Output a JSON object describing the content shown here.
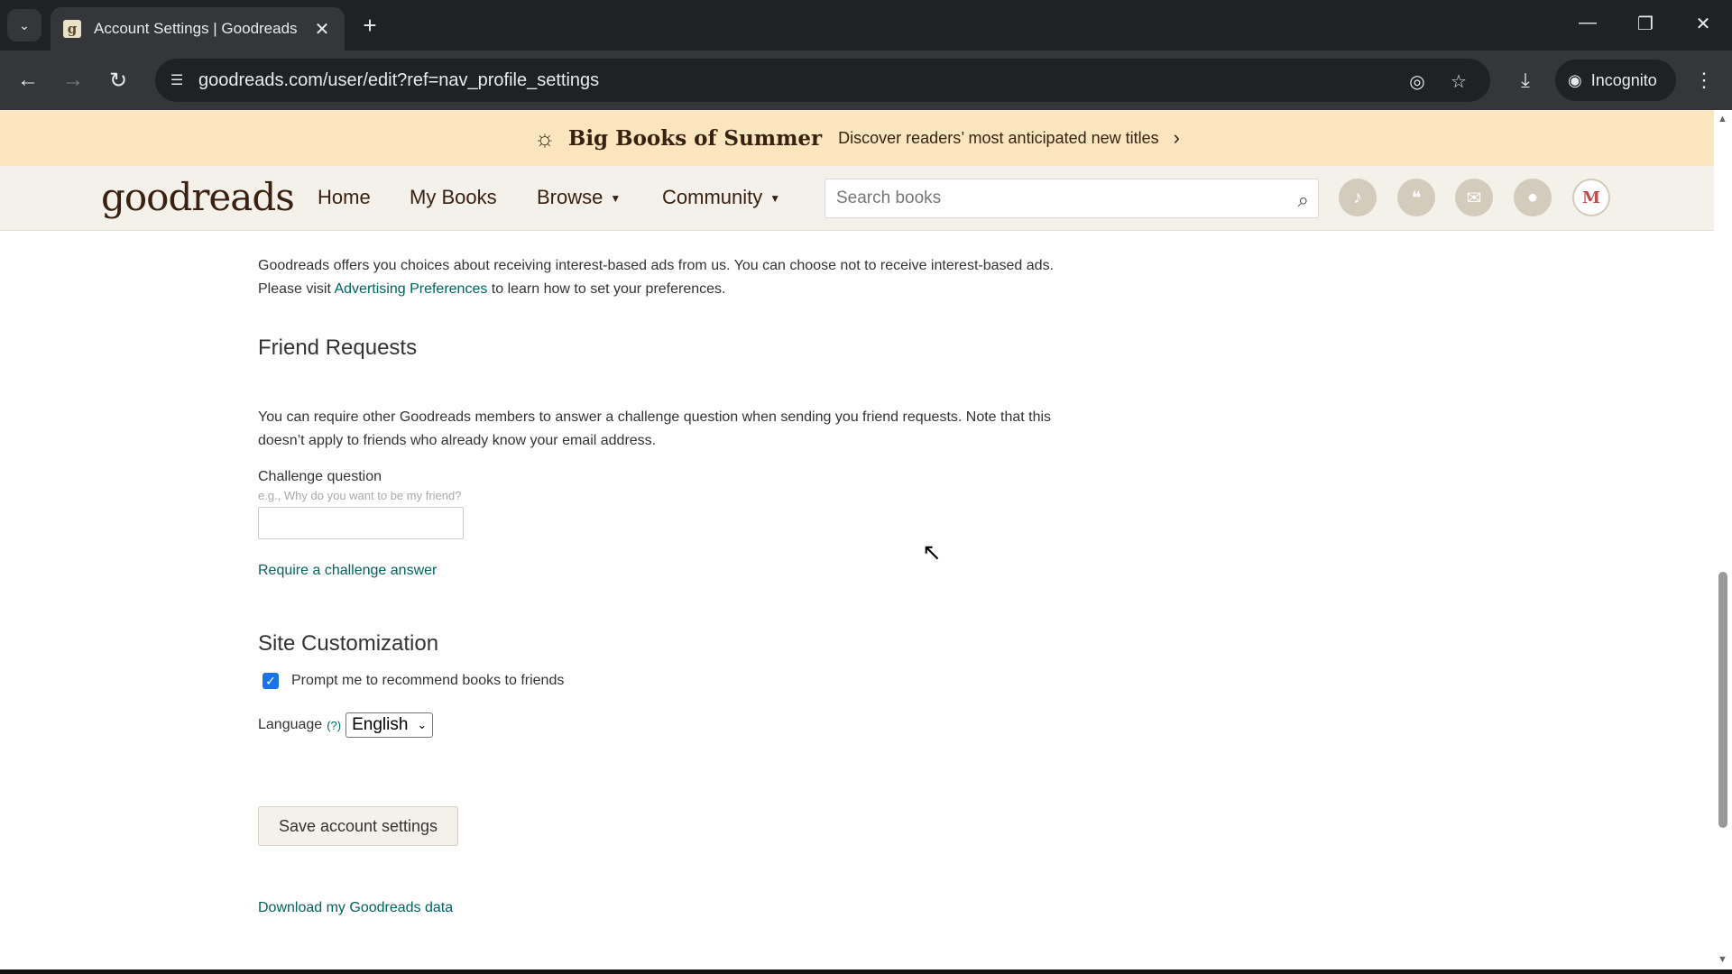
{
  "browser": {
    "tab_title": "Account Settings | Goodreads",
    "url": "goodreads.com/user/edit?ref=nav_profile_settings",
    "incognito_label": "Incognito"
  },
  "promo": {
    "title": "Big Books of Summer",
    "text": "Discover readers’ most anticipated new titles"
  },
  "header": {
    "logo": "goodreads",
    "nav": {
      "home": "Home",
      "my_books": "My Books",
      "browse": "Browse",
      "community": "Community"
    },
    "search_placeholder": "Search books",
    "avatar_letter": "M"
  },
  "ads": {
    "text_before": "Goodreads offers you choices about receiving interest-based ads from us. You can choose not to receive interest-based ads. Please visit ",
    "link": "Advertising Preferences",
    "text_after": " to learn how to set your preferences."
  },
  "friend_requests": {
    "heading": "Friend Requests",
    "description": "You can require other Goodreads members to answer a challenge question when sending you friend requests. Note that this doesn’t apply to friends who already know your email address.",
    "challenge_label": "Challenge question",
    "challenge_hint": "e.g., Why do you want to be my friend?",
    "challenge_value": "",
    "require_link": "Require a challenge answer"
  },
  "site_customization": {
    "heading": "Site Customization",
    "recommend_label": "Prompt me to recommend books to friends",
    "recommend_checked": true,
    "language_label": "Language",
    "language_help": "(?)",
    "language_value": "English"
  },
  "actions": {
    "save_label": "Save account settings",
    "download_link": "Download my Goodreads data"
  },
  "icons": {
    "notifications": "bell-icon",
    "discussions": "chat-bubble-icon",
    "messages": "envelope-icon",
    "friends": "person-icon"
  }
}
